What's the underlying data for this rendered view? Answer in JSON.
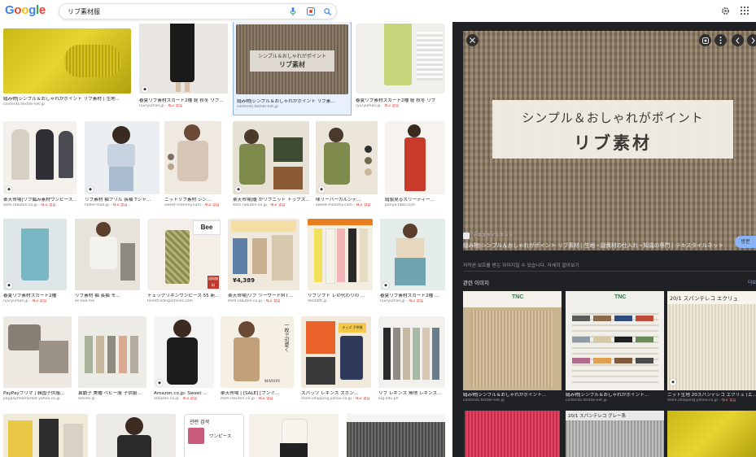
{
  "search": {
    "query": "リブ素材服",
    "logo_letters": [
      "G",
      "o",
      "o",
      "g",
      "l",
      "e"
    ],
    "logo_colors": [
      "#4285f4",
      "#ea4335",
      "#fbbc05",
      "#4285f4",
      "#34a853",
      "#ea4335"
    ]
  },
  "icons": {
    "mic": "mic-icon",
    "lens": "camera-icon",
    "search": "search-icon",
    "settings": "gear-icon",
    "apps": "apps-grid-icon",
    "close": "close-icon",
    "lens_panel": "lens-icon",
    "more": "more-icon",
    "prev": "chevron-left-icon",
    "next": "chevron-right-icon"
  },
  "colors": {
    "panel_bg": "#202124",
    "accent_blue": "#8ab4f8",
    "button_blue": "#8ab4f8",
    "ad_red": "#d93025"
  },
  "grid": {
    "row1": [
      {
        "title": "縫み物|シンプル＆おしゃれがポイント リブ素材 | 生地...",
        "source": "contents.textile-net.jp",
        "ad": ""
      },
      {
        "title": "春夏リブ素材スカート2種 軽 秋冬 リブ...",
        "source": "ryuryumall.jp",
        "ad": "제고 없음"
      },
      {
        "title": "縫み物|シンプル＆おしゃれがポイント リブ素...",
        "source": "contents.textile-net.jp",
        "ad": ""
      },
      {
        "title": "春夏リブ素材スカート2種 軽 秋冬 リブ",
        "source": "ryuryumall.jp",
        "ad": "제고 없음"
      }
    ],
    "row2": [
      {
        "title": "楽天市場|リブ編み素材ワンピース...",
        "source": "item.rakuten.co.jp",
        "ad": "재고 없음"
      },
      {
        "title": "リブ素材 袖フリル 長袖 Tシャ...",
        "source": "heller-mall.jp",
        "ad": "재고 없음"
      },
      {
        "title": "ニットリブ素材 シン...",
        "source": "sweet-mommy.com",
        "ad": "재고 없음"
      },
      {
        "title": "楽天市場|暖 かリブニット トップス...",
        "source": "item.rakuten.co.jp",
        "ad": "재고 없음"
      },
      {
        "title": "味リーバーカルンデ...",
        "source": "sweet-mommy.com",
        "ad": "재고 없음"
      },
      {
        "title": "縫製見るスリーティー...",
        "source": "panya-fabo.com",
        "ad": ""
      }
    ],
    "row3": [
      {
        "title": "春夏リブ素材スカート2種",
        "source": "ryuryumall.jp",
        "ad": "재고 없음"
      },
      {
        "title": "リブ素材 袖 長袖 モ...",
        "source": "ec-line.me",
        "ad": ""
      },
      {
        "title": "チェックリネンワンピース 55 新...",
        "source": "forestradingarticles.com",
        "ad": ""
      },
      {
        "title": "楽天市場|リブ ツーワードM I ...",
        "source": "item.rakuten.co.jp",
        "ad": "재고 없음"
      },
      {
        "title": "リブソフト レの代わりの ...",
        "source": "dentaflt.jp",
        "ad": ""
      },
      {
        "title": "春夏リブ素材スカート2種 ...",
        "source": "ryuryumall.jp",
        "ad": "재고 없음"
      }
    ],
    "row3_texts": {
      "bee": "Bee",
      "price": "¥4,389",
      "sale": "送料無料"
    },
    "row4": [
      {
        "title": "PayPayフリマ | 韓国子供服...",
        "source": "paypayfleamarket.yahoo.co.jp",
        "ad": ""
      },
      {
        "title": "異動子 美種 ベビー服 子供服...",
        "source": "amiles.jp",
        "ad": ""
      },
      {
        "title": "Amazon.co.jp: Sweet ...",
        "source": "amazon.co.jp",
        "ad": "재고 없음"
      },
      {
        "title": "楽天市場 | [SALE] [プンミ...",
        "source": "item.rakuten.co.jp",
        "ad": "재고 없음"
      },
      {
        "title": "スパッツ レギンス ズボン...",
        "source": "store.shopping.yahoo.co.jp",
        "ad": "재고 없음"
      },
      {
        "title": "リブ レギンス 無地 レギンス...",
        "source": "lug.edu.ph",
        "ad": ""
      }
    ],
    "row4_texts": {
      "poster": "一枚で可愛く",
      "manon": "MANON",
      "kids": "キッズ 子供服"
    },
    "row5": {
      "suggest_title": "관련 검색",
      "suggest_item": "ワンピース"
    }
  },
  "panel": {
    "hero_line1": "シンプル＆おしゃれがポイント",
    "hero_line2": "リブ素材",
    "site": "テキスタイルネット",
    "title": "縫み物|シンプル＆おしゃれがポイント リブ素材 | 生地・副資材の仕入れ・知識の専門 | テキスタイルネット",
    "visit": "방문",
    "notice": "저작권 보호를 받는 이미지일 수 있습니다. 자세히 알아보기",
    "related_title": "관련 이미지",
    "more_label": "더보기",
    "related": [
      {
        "title": "縫み物|シンプル＆おしゃれがポイント...",
        "source": "contents.textile-net.jp",
        "ad": "",
        "label": "TNC"
      },
      {
        "title": "縫み物|シンプル＆おしゃれがポイント...",
        "source": "contents.textile-net.jp",
        "ad": "",
        "label": "TNC"
      },
      {
        "title": "ニット生地 20スパンテレコ エクリュ (エ...",
        "source": "store.shopping.yahoo.co.jp",
        "ad": "재고 없음",
        "label": "20/1 スパンテレコ エクリュ"
      }
    ],
    "related_row2_label": "20/1 スパンテレコ グレー系"
  }
}
